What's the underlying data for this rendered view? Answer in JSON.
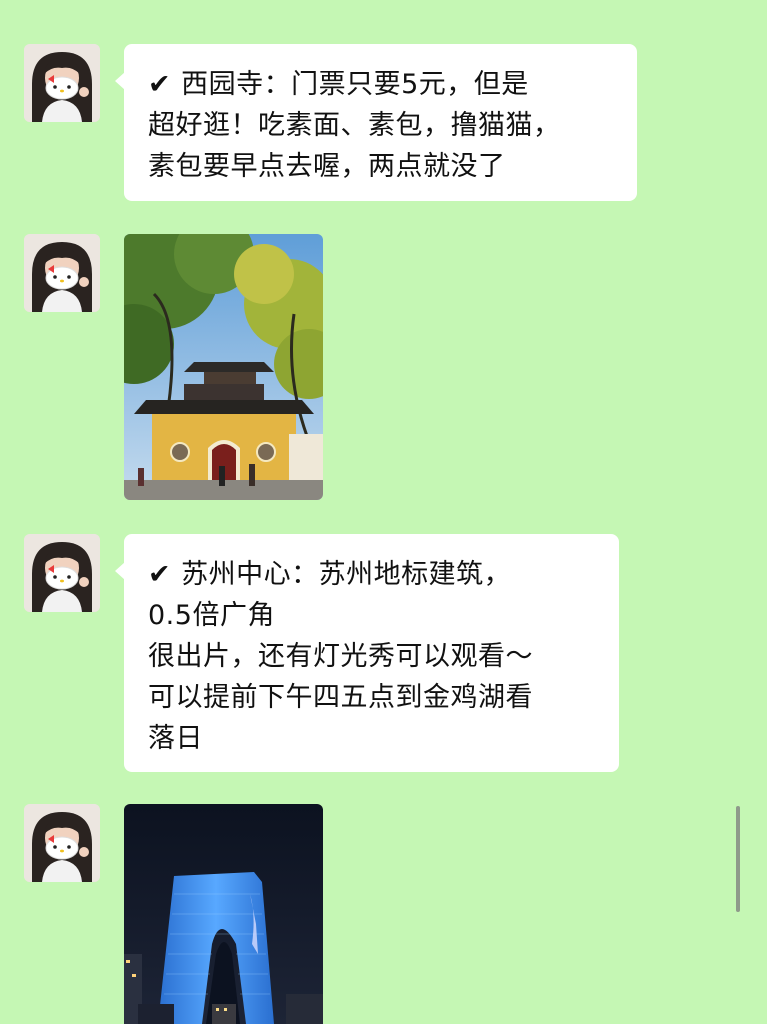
{
  "chat": {
    "background_color": "#c5f7b4",
    "bubble_color": "#ffffff",
    "messages": [
      {
        "type": "text",
        "check_icon": "✔",
        "lines": [
          "西园寺：门票只要5元，但是",
          "超好逛！吃素面、素包，撸猫猫，",
          "素包要早点去喔，两点就没了"
        ]
      },
      {
        "type": "image",
        "icon": "temple-photo"
      },
      {
        "type": "text",
        "check_icon": "✔",
        "lines": [
          "苏州中心：苏州地标建筑，",
          "0.5倍广角",
          "很出片，还有灯光秀可以观看～",
          "可以提前下午四五点到金鸡湖看",
          "落日"
        ]
      },
      {
        "type": "image",
        "icon": "gate-of-orient-night-photo"
      }
    ]
  }
}
